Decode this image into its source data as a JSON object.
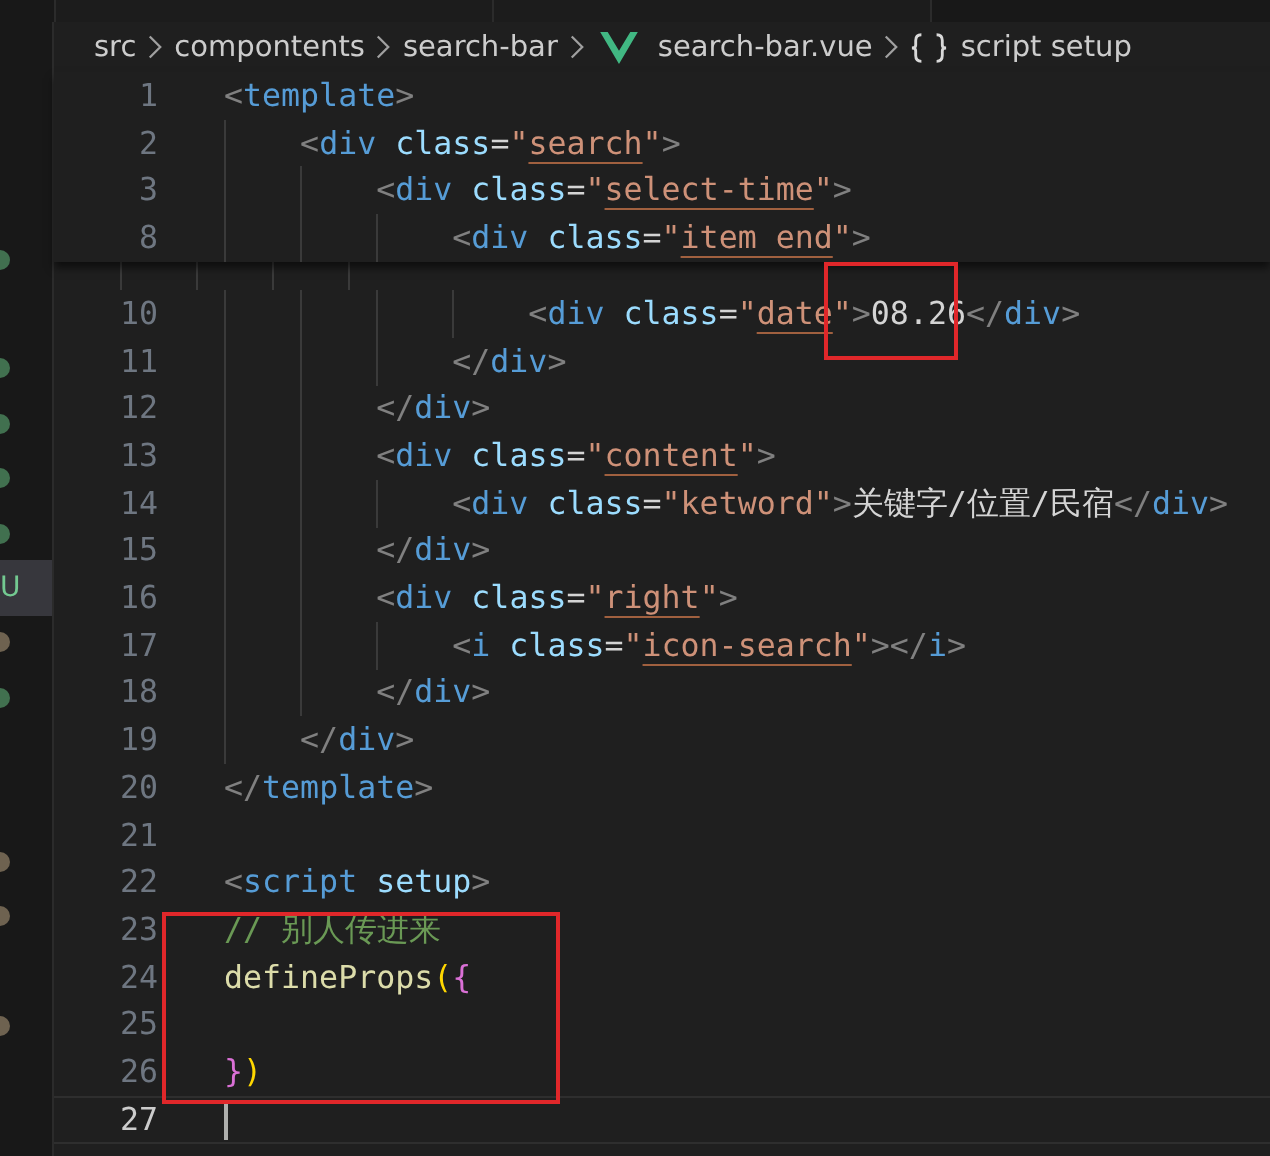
{
  "breadcrumb": [
    {
      "kind": "folder",
      "label": "src"
    },
    {
      "kind": "folder",
      "label": "compontents"
    },
    {
      "kind": "folder",
      "label": "search-bar"
    },
    {
      "kind": "vue",
      "label": "search-bar.vue"
    },
    {
      "kind": "braces",
      "label": "script setup"
    }
  ],
  "explorer": [
    {
      "selected": false,
      "mark": {
        "kind": "dot",
        "color": "#41704f"
      }
    },
    {
      "selected": false,
      "mark": {
        "kind": "dot",
        "color": "#41704f"
      }
    },
    {
      "selected": false,
      "mark": {
        "kind": "dot",
        "color": "#41704f"
      }
    },
    {
      "selected": false,
      "mark": {
        "kind": "dot",
        "color": "#41704f"
      }
    },
    {
      "selected": false,
      "mark": {
        "kind": "dot",
        "color": "#41704f"
      }
    },
    {
      "selected": true,
      "mark": {
        "kind": "letter",
        "text": "U"
      }
    },
    {
      "selected": false,
      "mark": {
        "kind": "dot",
        "color": "#6e6250"
      }
    },
    {
      "selected": false,
      "mark": {
        "kind": "dot",
        "color": "#41704f"
      }
    },
    {
      "selected": false,
      "mark": {
        "kind": "dot",
        "color": "#6e6250"
      }
    },
    {
      "selected": false,
      "mark": {
        "kind": "dot",
        "color": "#6e6250"
      }
    },
    {
      "selected": false,
      "mark": {
        "kind": "dot",
        "color": "#6e6250"
      }
    }
  ],
  "sticky_lines": [
    {
      "number": "1",
      "tokens": [
        {
          "kind": "punct",
          "text": "<"
        },
        {
          "kind": "tag",
          "text": "template"
        },
        {
          "kind": "punct",
          "text": ">"
        }
      ]
    },
    {
      "number": "2",
      "tokens": [
        {
          "kind": "punct",
          "text": "    <"
        },
        {
          "kind": "tag",
          "text": "div"
        },
        {
          "kind": "attr",
          "text": " class"
        },
        {
          "kind": "plain",
          "text": "="
        },
        {
          "kind": "string",
          "text": "\""
        },
        {
          "kind": "ref",
          "text": "search"
        },
        {
          "kind": "string",
          "text": "\""
        },
        {
          "kind": "punct",
          "text": ">"
        }
      ]
    },
    {
      "number": "3",
      "tokens": [
        {
          "kind": "punct",
          "text": "        <"
        },
        {
          "kind": "tag",
          "text": "div"
        },
        {
          "kind": "attr",
          "text": " class"
        },
        {
          "kind": "plain",
          "text": "="
        },
        {
          "kind": "string",
          "text": "\""
        },
        {
          "kind": "ref",
          "text": "select-time"
        },
        {
          "kind": "string",
          "text": "\""
        },
        {
          "kind": "punct",
          "text": ">"
        }
      ]
    },
    {
      "number": "8",
      "tokens": [
        {
          "kind": "punct",
          "text": "            <"
        },
        {
          "kind": "tag",
          "text": "div"
        },
        {
          "kind": "attr",
          "text": " class"
        },
        {
          "kind": "plain",
          "text": "="
        },
        {
          "kind": "string",
          "text": "\""
        },
        {
          "kind": "ref",
          "text": "item end"
        },
        {
          "kind": "string",
          "text": "\""
        },
        {
          "kind": "punct",
          "text": ">"
        }
      ]
    }
  ],
  "lines": [
    {
      "number": "10",
      "current": false,
      "tokens": [
        {
          "kind": "punct",
          "text": "                <"
        },
        {
          "kind": "tag",
          "text": "div"
        },
        {
          "kind": "attr",
          "text": " class"
        },
        {
          "kind": "plain",
          "text": "="
        },
        {
          "kind": "string",
          "text": "\""
        },
        {
          "kind": "ref",
          "text": "date"
        },
        {
          "kind": "string",
          "text": "\""
        },
        {
          "kind": "punct",
          "text": ">"
        },
        {
          "kind": "plain",
          "text": "08.26"
        },
        {
          "kind": "punct",
          "text": "</"
        },
        {
          "kind": "tag",
          "text": "div"
        },
        {
          "kind": "punct",
          "text": ">"
        }
      ]
    },
    {
      "number": "11",
      "current": false,
      "tokens": [
        {
          "kind": "punct",
          "text": "            </"
        },
        {
          "kind": "tag",
          "text": "div"
        },
        {
          "kind": "punct",
          "text": ">"
        }
      ]
    },
    {
      "number": "12",
      "current": false,
      "tokens": [
        {
          "kind": "punct",
          "text": "        </"
        },
        {
          "kind": "tag",
          "text": "div"
        },
        {
          "kind": "punct",
          "text": ">"
        }
      ]
    },
    {
      "number": "13",
      "current": false,
      "tokens": [
        {
          "kind": "punct",
          "text": "        <"
        },
        {
          "kind": "tag",
          "text": "div"
        },
        {
          "kind": "attr",
          "text": " class"
        },
        {
          "kind": "plain",
          "text": "="
        },
        {
          "kind": "string",
          "text": "\""
        },
        {
          "kind": "ref",
          "text": "content"
        },
        {
          "kind": "string",
          "text": "\""
        },
        {
          "kind": "punct",
          "text": ">"
        }
      ]
    },
    {
      "number": "14",
      "current": false,
      "tokens": [
        {
          "kind": "punct",
          "text": "            <"
        },
        {
          "kind": "tag",
          "text": "div"
        },
        {
          "kind": "attr",
          "text": " class"
        },
        {
          "kind": "plain",
          "text": "="
        },
        {
          "kind": "string",
          "text": "\"ketword\""
        },
        {
          "kind": "punct",
          "text": ">"
        },
        {
          "kind": "plain",
          "text": "关键字/位置/民宿"
        },
        {
          "kind": "punct",
          "text": "</"
        },
        {
          "kind": "tag",
          "text": "div"
        },
        {
          "kind": "punct",
          "text": ">"
        }
      ]
    },
    {
      "number": "15",
      "current": false,
      "tokens": [
        {
          "kind": "punct",
          "text": "        </"
        },
        {
          "kind": "tag",
          "text": "div"
        },
        {
          "kind": "punct",
          "text": ">"
        }
      ]
    },
    {
      "number": "16",
      "current": false,
      "tokens": [
        {
          "kind": "punct",
          "text": "        <"
        },
        {
          "kind": "tag",
          "text": "div"
        },
        {
          "kind": "attr",
          "text": " class"
        },
        {
          "kind": "plain",
          "text": "="
        },
        {
          "kind": "string",
          "text": "\""
        },
        {
          "kind": "ref",
          "text": "right"
        },
        {
          "kind": "string",
          "text": "\""
        },
        {
          "kind": "punct",
          "text": ">"
        }
      ]
    },
    {
      "number": "17",
      "current": false,
      "tokens": [
        {
          "kind": "punct",
          "text": "            <"
        },
        {
          "kind": "tag",
          "text": "i"
        },
        {
          "kind": "attr",
          "text": " class"
        },
        {
          "kind": "plain",
          "text": "="
        },
        {
          "kind": "string",
          "text": "\""
        },
        {
          "kind": "ref",
          "text": "icon-search"
        },
        {
          "kind": "string",
          "text": "\""
        },
        {
          "kind": "punct",
          "text": "></"
        },
        {
          "kind": "tag",
          "text": "i"
        },
        {
          "kind": "punct",
          "text": ">"
        }
      ]
    },
    {
      "number": "18",
      "current": false,
      "tokens": [
        {
          "kind": "punct",
          "text": "        </"
        },
        {
          "kind": "tag",
          "text": "div"
        },
        {
          "kind": "punct",
          "text": ">"
        }
      ]
    },
    {
      "number": "19",
      "current": false,
      "tokens": [
        {
          "kind": "punct",
          "text": "    </"
        },
        {
          "kind": "tag",
          "text": "div"
        },
        {
          "kind": "punct",
          "text": ">"
        }
      ]
    },
    {
      "number": "20",
      "current": false,
      "tokens": [
        {
          "kind": "punct",
          "text": "</"
        },
        {
          "kind": "tag",
          "text": "template"
        },
        {
          "kind": "punct",
          "text": ">"
        }
      ]
    },
    {
      "number": "21",
      "current": false
    },
    {
      "number": "22",
      "current": false,
      "tokens": [
        {
          "kind": "punct",
          "text": "<"
        },
        {
          "kind": "tag",
          "text": "script"
        },
        {
          "kind": "attr",
          "text": " setup"
        },
        {
          "kind": "punct",
          "text": ">"
        }
      ]
    },
    {
      "number": "23",
      "current": false,
      "tokens": [
        {
          "kind": "comment",
          "text": "// 别人传进来"
        }
      ]
    },
    {
      "number": "24",
      "current": false,
      "tokens": [
        {
          "kind": "func",
          "text": "defineProps"
        },
        {
          "kind": "paren",
          "text": "("
        },
        {
          "kind": "brace",
          "text": "{"
        }
      ]
    },
    {
      "number": "25",
      "current": false
    },
    {
      "number": "26",
      "current": false,
      "tokens": [
        {
          "kind": "brace",
          "text": "}"
        },
        {
          "kind": "paren",
          "text": ")"
        }
      ]
    },
    {
      "number": "27",
      "current": true
    }
  ]
}
